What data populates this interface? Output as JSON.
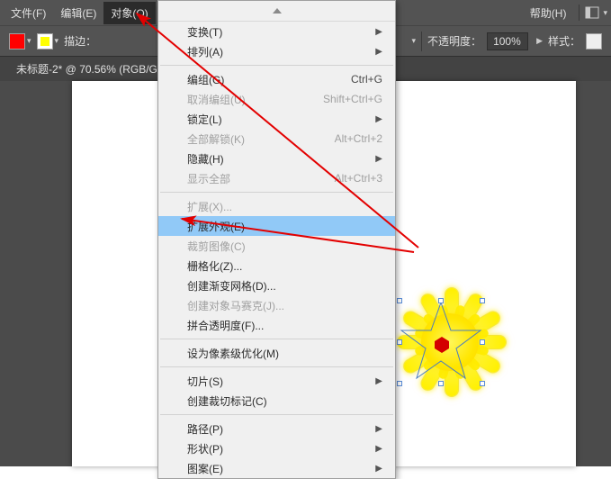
{
  "menubar": {
    "file": "文件(F)",
    "edit": "编辑(E)",
    "object": "对象(O)",
    "help": "帮助(H)"
  },
  "toolbar": {
    "fill_color": "#ff0000",
    "stroke_color_outer": "#ffff00",
    "stroke_label": "描边：",
    "opacity_label": "不透明度：",
    "opacity_value": "100%",
    "style_label": "样式："
  },
  "doctab": "未标题-2* @ 70.56% (RGB/G",
  "menu": {
    "items": [
      {
        "label": "变换(T)",
        "sub": true
      },
      {
        "label": "排列(A)",
        "sub": true
      },
      {
        "sep": true
      },
      {
        "label": "编组(G)",
        "shortcut": "Ctrl+G"
      },
      {
        "label": "取消编组(U)",
        "shortcut": "Shift+Ctrl+G",
        "disabled": true
      },
      {
        "label": "锁定(L)",
        "sub": true
      },
      {
        "label": "全部解锁(K)",
        "shortcut": "Alt+Ctrl+2",
        "disabled": true
      },
      {
        "label": "隐藏(H)",
        "sub": true
      },
      {
        "label": "显示全部",
        "shortcut": "Alt+Ctrl+3",
        "disabled": true
      },
      {
        "sep": true
      },
      {
        "label": "扩展(X)...",
        "disabled": true
      },
      {
        "label": "扩展外观(E)",
        "highlight": true
      },
      {
        "label": "裁剪图像(C)",
        "disabled": true
      },
      {
        "label": "栅格化(Z)..."
      },
      {
        "label": "创建渐变网格(D)..."
      },
      {
        "label": "创建对象马赛克(J)...",
        "disabled": true
      },
      {
        "label": "拼合透明度(F)..."
      },
      {
        "sep": true
      },
      {
        "label": "设为像素级优化(M)"
      },
      {
        "sep": true
      },
      {
        "label": "切片(S)",
        "sub": true
      },
      {
        "label": "创建裁切标记(C)"
      },
      {
        "sep": true
      },
      {
        "label": "路径(P)",
        "sub": true
      },
      {
        "label": "形状(P)",
        "sub": true
      },
      {
        "label": "图案(E)",
        "sub": true
      }
    ]
  }
}
